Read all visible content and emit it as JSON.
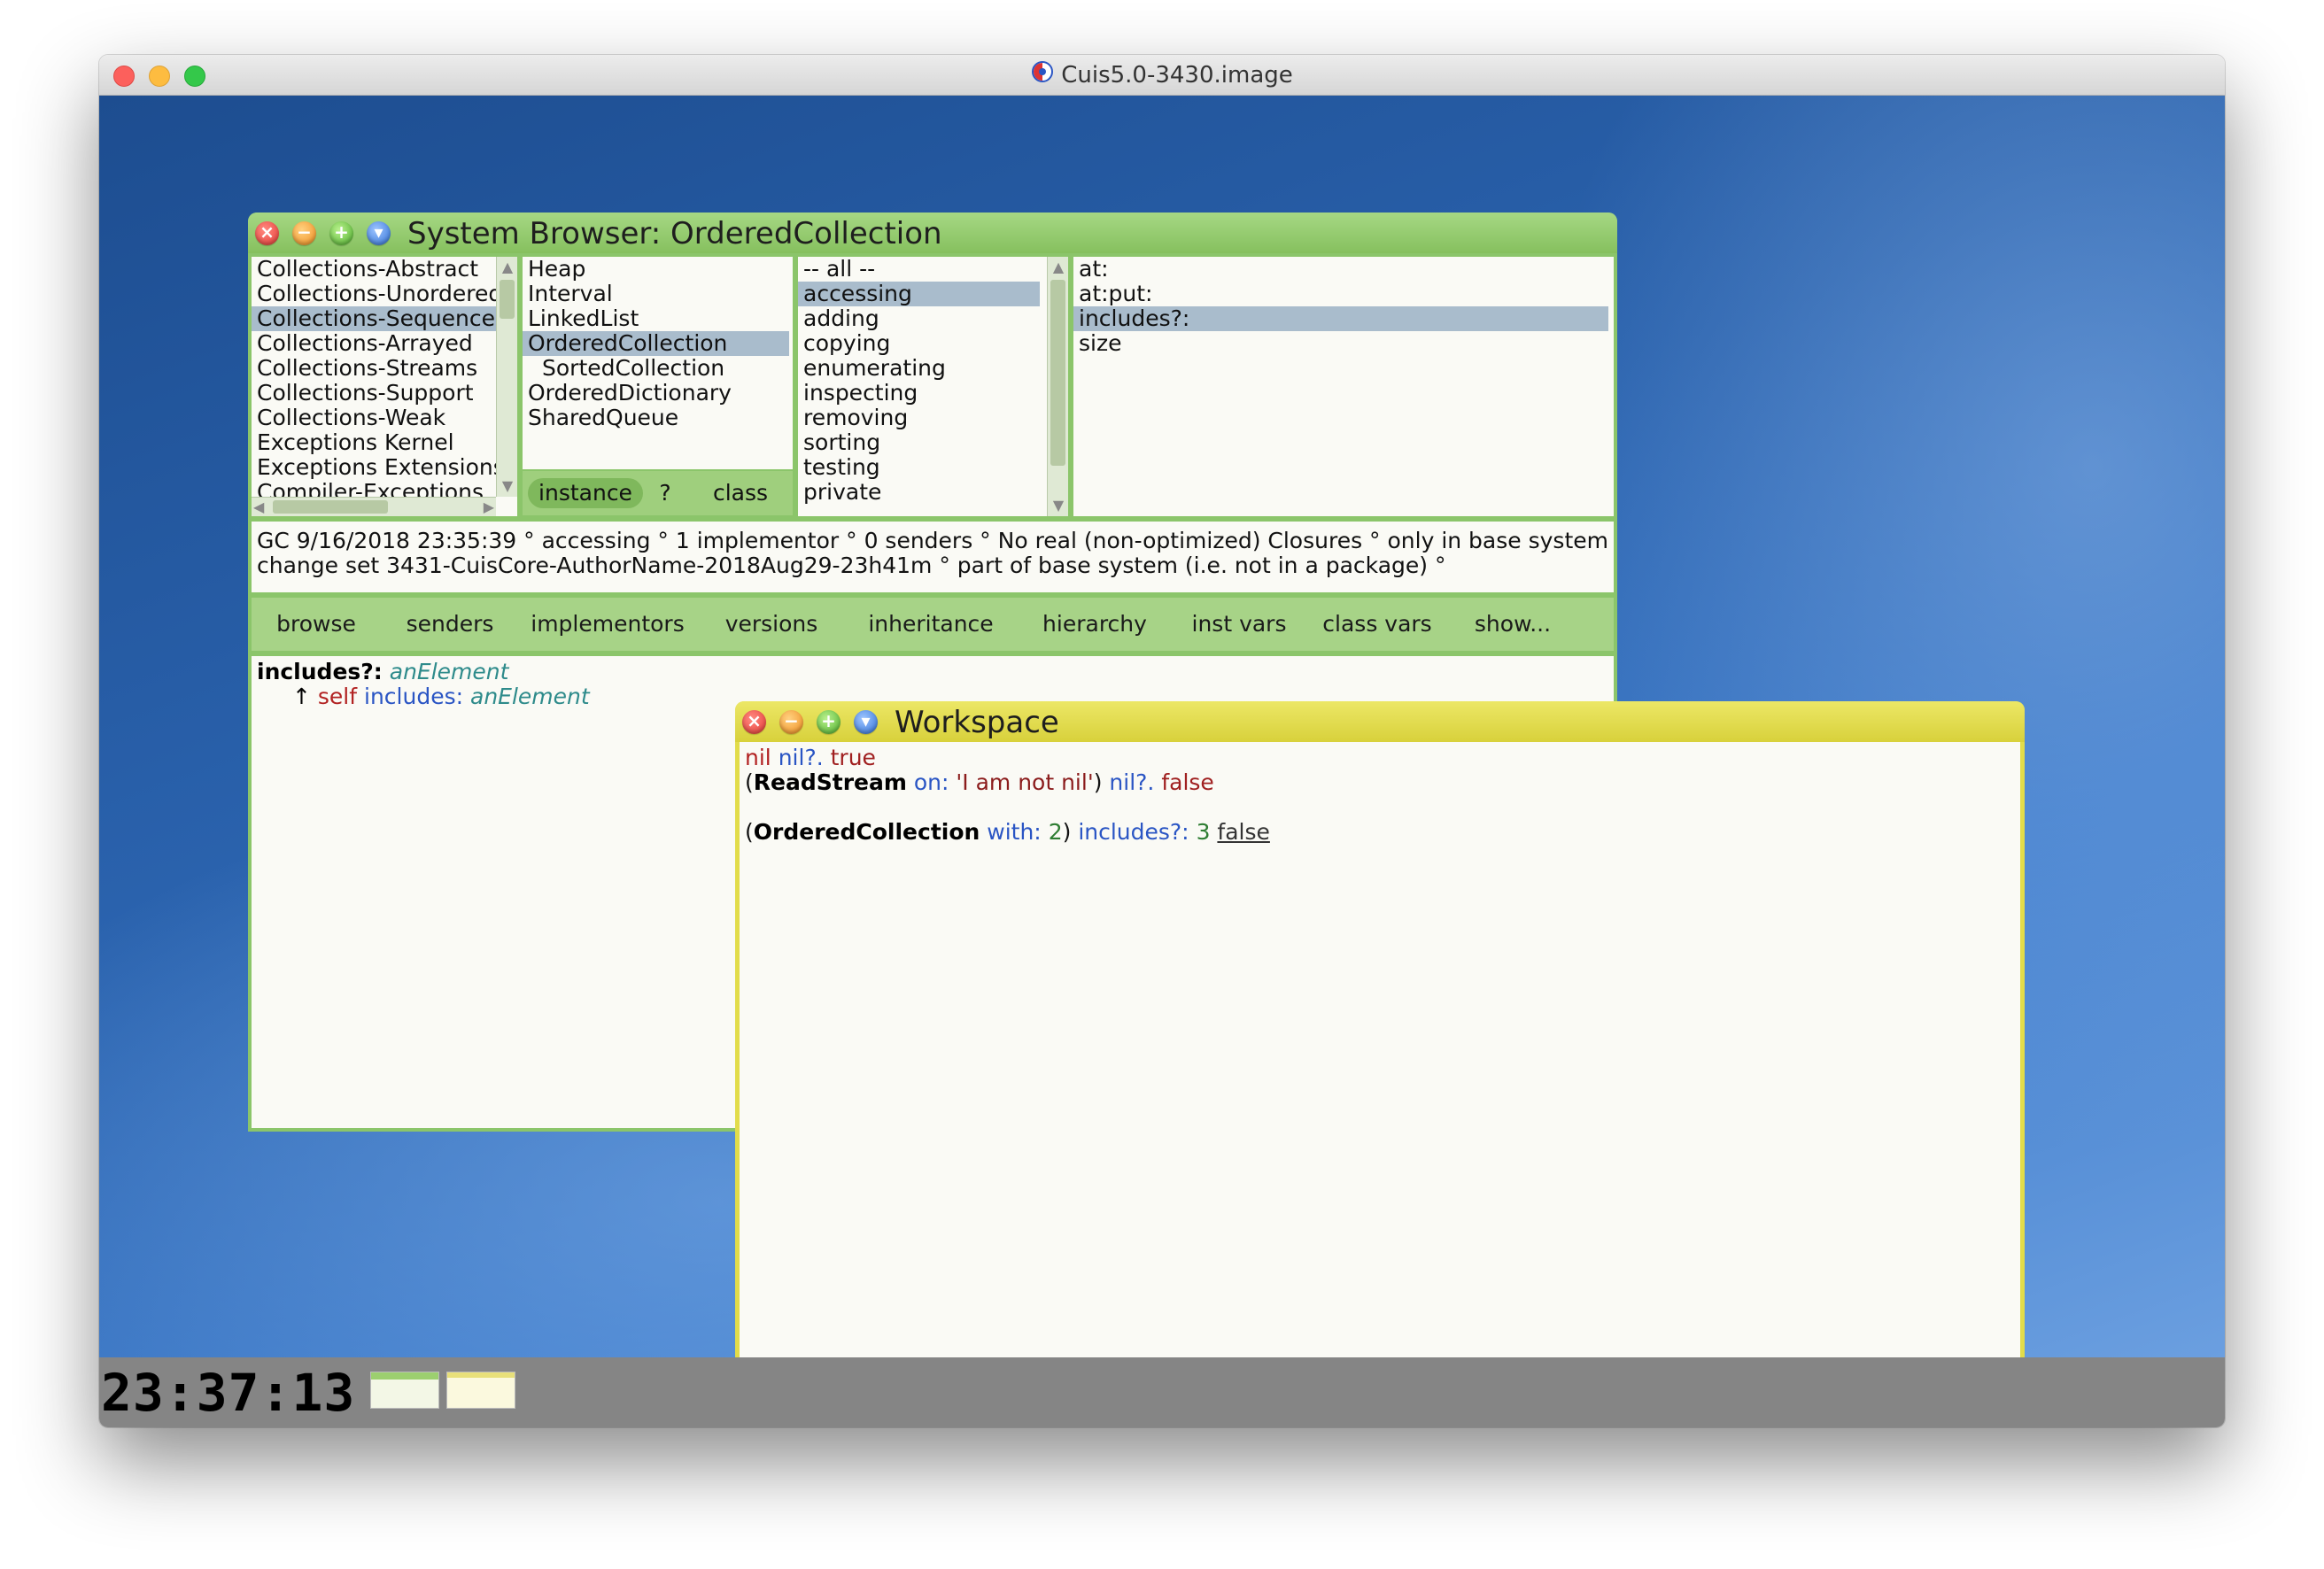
{
  "mac": {
    "title": "Cuis5.0-3430.image"
  },
  "browser": {
    "title": "System Browser: OrderedCollection",
    "categories": [
      "Collections-Abstract",
      "Collections-Unordered",
      "Collections-Sequenceable",
      "Collections-Arrayed",
      "Collections-Streams",
      "Collections-Support",
      "Collections-Weak",
      "Exceptions Kernel",
      "Exceptions Extensions",
      "Compiler-Exceptions"
    ],
    "classes": [
      "Heap",
      "Interval",
      "LinkedList",
      "OrderedCollection",
      "SortedCollection",
      "OrderedDictionary",
      "SharedQueue"
    ],
    "toggles": {
      "instance": "instance",
      "help": "?",
      "class": "class"
    },
    "protocols": [
      "-- all --",
      "accessing",
      "adding",
      "copying",
      "enumerating",
      "inspecting",
      "removing",
      "sorting",
      "testing",
      "private"
    ],
    "selectors": [
      "at:",
      "at:put:",
      "includes?:",
      "size"
    ],
    "annotation": {
      "line1": "GC 9/16/2018 23:35:39 ° accessing ° 1 implementor ° 0 senders ° No real (non-optimized) Closures ° only in base system",
      "line2": "change set 3431-CuisCore-AuthorName-2018Aug29-23h41m ° part of base system (i.e. not in a package) °"
    },
    "buttons": [
      "browse",
      "senders",
      "implementors",
      "versions",
      "inheritance",
      "hierarchy",
      "inst vars",
      "class vars",
      "show..."
    ],
    "code": {
      "selector": "includes?:",
      "arg": "anElement",
      "caret": "↑",
      "self": "self",
      "send": "includes:",
      "arg2": "anElement"
    }
  },
  "workspace": {
    "title": "Workspace",
    "line1": {
      "recv": "nil",
      "msg": "nil?.",
      "result": "true"
    },
    "line2": {
      "open": "(",
      "cls": "ReadStream",
      "kw": "on:",
      "str": "'I am not nil'",
      "close": ")",
      "msg": "nil?.",
      "result": "false"
    },
    "line3": {
      "open": "(",
      "cls": "OrderedCollection",
      "kw": "with:",
      "num": "2",
      "close": ")",
      "msg": "includes?:",
      "num2": "3",
      "result": "false"
    }
  },
  "taskbar": {
    "clock": "23:37:13"
  }
}
